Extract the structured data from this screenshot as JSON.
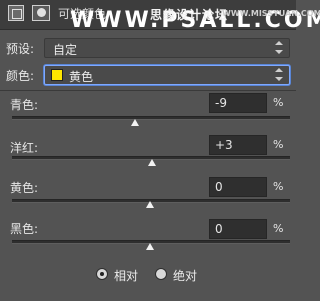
{
  "header": {
    "title": "可选颜色",
    "watermark_logo": "WWW.PSALL.COM",
    "watermark_cn": "思缘设计论坛",
    "watermark_url": "WWW.MISSYUAN.COM"
  },
  "preset": {
    "label": "预设:",
    "value": "自定"
  },
  "color": {
    "label": "颜色:",
    "value": "黄色",
    "swatch": "#ffe600"
  },
  "sliders": [
    {
      "label": "青色:",
      "value": "-9",
      "unit": "%",
      "level": -9
    },
    {
      "label": "洋红:",
      "value": "+3",
      "unit": "%",
      "level": 3
    },
    {
      "label": "黄色:",
      "value": "0",
      "unit": "%",
      "level": 0
    },
    {
      "label": "黑色:",
      "value": "0",
      "unit": "%",
      "level": 0
    }
  ],
  "method": {
    "options": [
      "相对",
      "绝对"
    ],
    "selected": "相对"
  }
}
